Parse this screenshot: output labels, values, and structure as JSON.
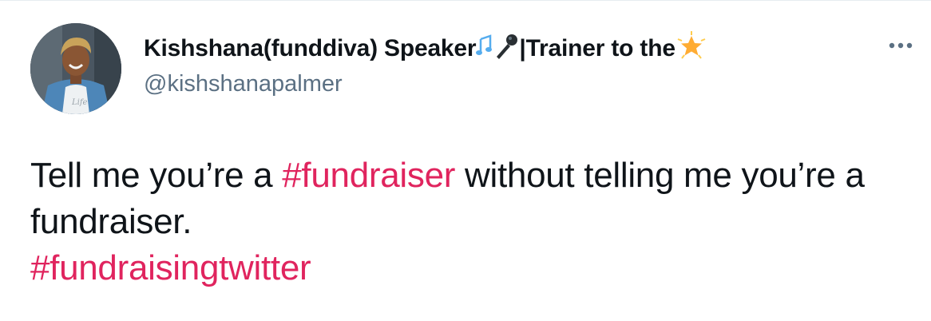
{
  "tweet": {
    "author": {
      "name_part1": "Kishshana(funddiva) Speaker",
      "name_part2": "|Trainer to the ",
      "handle": "@kishshanapalmer",
      "emoji_1": "musical-notes-icon",
      "emoji_2": "microphone-icon",
      "emoji_3": "star-icon"
    },
    "text": {
      "part1": "Tell me you’re a ",
      "hashtag1": "#fundraiser",
      "part2": " without telling me you’re a fundraiser.",
      "hashtag2": "#fundraisingtwitter"
    },
    "colors": {
      "hashtag": "#e0245e",
      "handle": "#5b7083",
      "text": "#0f1419"
    }
  }
}
